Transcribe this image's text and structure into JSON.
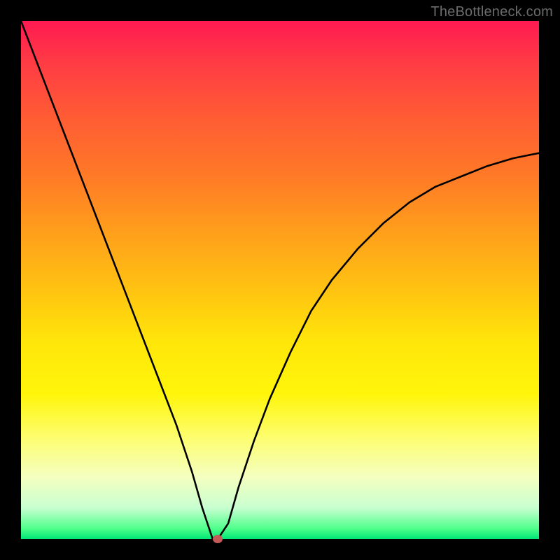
{
  "watermark": "TheBottleneck.com",
  "chart_data": {
    "type": "line",
    "title": "",
    "xlabel": "",
    "ylabel": "",
    "xlim": [
      0,
      100
    ],
    "ylim": [
      0,
      100
    ],
    "grid": false,
    "legend": false,
    "series": [
      {
        "name": "bottleneck-curve",
        "x": [
          0,
          5,
          10,
          15,
          20,
          25,
          30,
          33,
          35,
          37,
          38,
          40,
          42,
          45,
          48,
          52,
          56,
          60,
          65,
          70,
          75,
          80,
          85,
          90,
          95,
          100
        ],
        "y": [
          100,
          87,
          74,
          61,
          48,
          35,
          22,
          13,
          6,
          0,
          0,
          3,
          10,
          19,
          27,
          36,
          44,
          50,
          56,
          61,
          65,
          68,
          70,
          72,
          73.5,
          74.5
        ]
      }
    ],
    "marker": {
      "x": 38,
      "y": 0,
      "color": "#c45a57"
    },
    "gradient_stops": [
      {
        "pos": 0,
        "color": "#ff1a52"
      },
      {
        "pos": 18,
        "color": "#ff5a35"
      },
      {
        "pos": 42,
        "color": "#ffa31a"
      },
      {
        "pos": 62,
        "color": "#ffe60a"
      },
      {
        "pos": 88,
        "color": "#f5ffc0"
      },
      {
        "pos": 100,
        "color": "#00e676"
      }
    ]
  }
}
